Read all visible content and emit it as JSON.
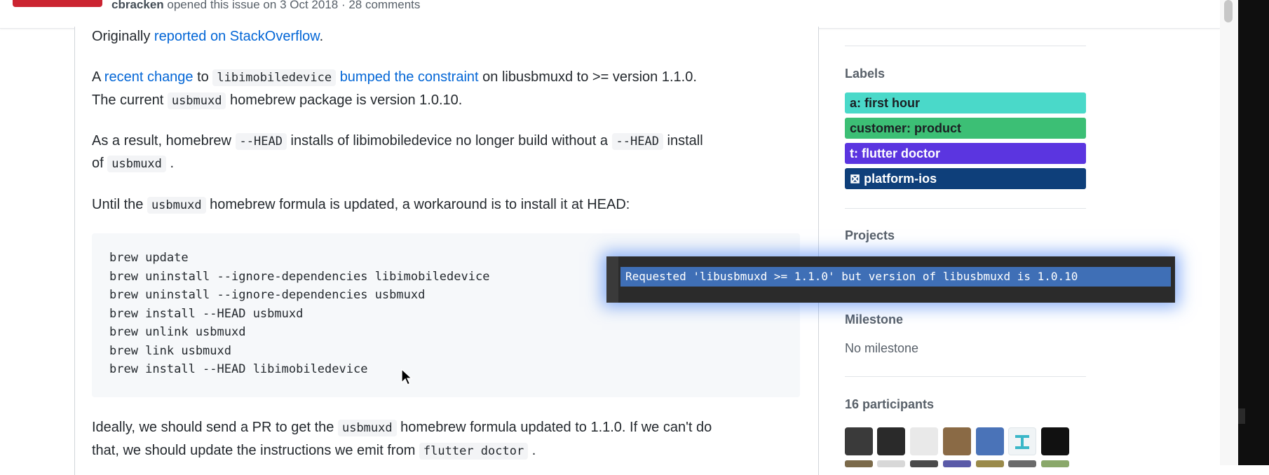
{
  "header": {
    "author": "cbracken",
    "meta": " opened this issue on 3 Oct 2018 · 28 comments"
  },
  "body": {
    "p1": {
      "prefix": "Originally ",
      "link": "reported on StackOverflow",
      "suffix": "."
    },
    "p2": {
      "t1": "A ",
      "link1": "recent change",
      "t2": " to ",
      "code1": "libimobiledevice",
      "t3": " ",
      "link2": "bumped the constraint",
      "t4": " on libusbmuxd to >= version 1.1.0.",
      "l2a": "The current ",
      "code2": "usbmuxd",
      "l2b": " homebrew package is version 1.0.10."
    },
    "p3": {
      "t1": "As a result, homebrew ",
      "code1": "--HEAD",
      "t2": " installs of libimobiledevice no longer build without a ",
      "code2": "--HEAD",
      "t3": " install",
      "l2a": "of ",
      "code3": "usbmuxd",
      "l2b": " ."
    },
    "p4": {
      "t1": "Until the ",
      "code1": "usbmuxd",
      "t2": " homebrew formula is updated, a workaround is to install it at HEAD:"
    },
    "code_lines": [
      "brew update",
      "brew uninstall --ignore-dependencies libimobiledevice",
      "brew uninstall --ignore-dependencies usbmuxd",
      "brew install --HEAD usbmuxd",
      "brew unlink usbmuxd",
      "brew link usbmuxd",
      "brew install --HEAD libimobiledevice"
    ],
    "p5": {
      "t1": "Ideally, we should send a PR to get the ",
      "code1": "usbmuxd",
      "t2": " homebrew formula updated to 1.1.0. If we can't do",
      "l2a": "that, we should update the instructions we emit from ",
      "code2": "flutter doctor",
      "l2b": " ."
    }
  },
  "sidebar": {
    "labels_heading": "Labels",
    "labels": [
      {
        "text": "a: first hour",
        "bg": "#4ad9c9",
        "fg": "#1b1f23"
      },
      {
        "text": "customer: product",
        "bg": "#3cbf75",
        "fg": "#1b1f23"
      },
      {
        "text": "t: flutter doctor",
        "bg": "#5b35e0",
        "fg": "#ffffff"
      },
      {
        "text": "⊠ platform-ios",
        "bg": "#0e3f7a",
        "fg": "#ffffff"
      }
    ],
    "projects_heading": "Projects",
    "milestone_heading": "Milestone",
    "milestone_value": "No milestone",
    "participants_heading": "16 participants"
  },
  "terminal": {
    "selected_line": "Requested 'libusbmuxd >= 1.1.0' but version of libusbmuxd is 1.0.10"
  },
  "colors": {
    "link": "#0366d6",
    "badge_red": "#cb2431",
    "terminal_glow": "#2f6ff0"
  }
}
